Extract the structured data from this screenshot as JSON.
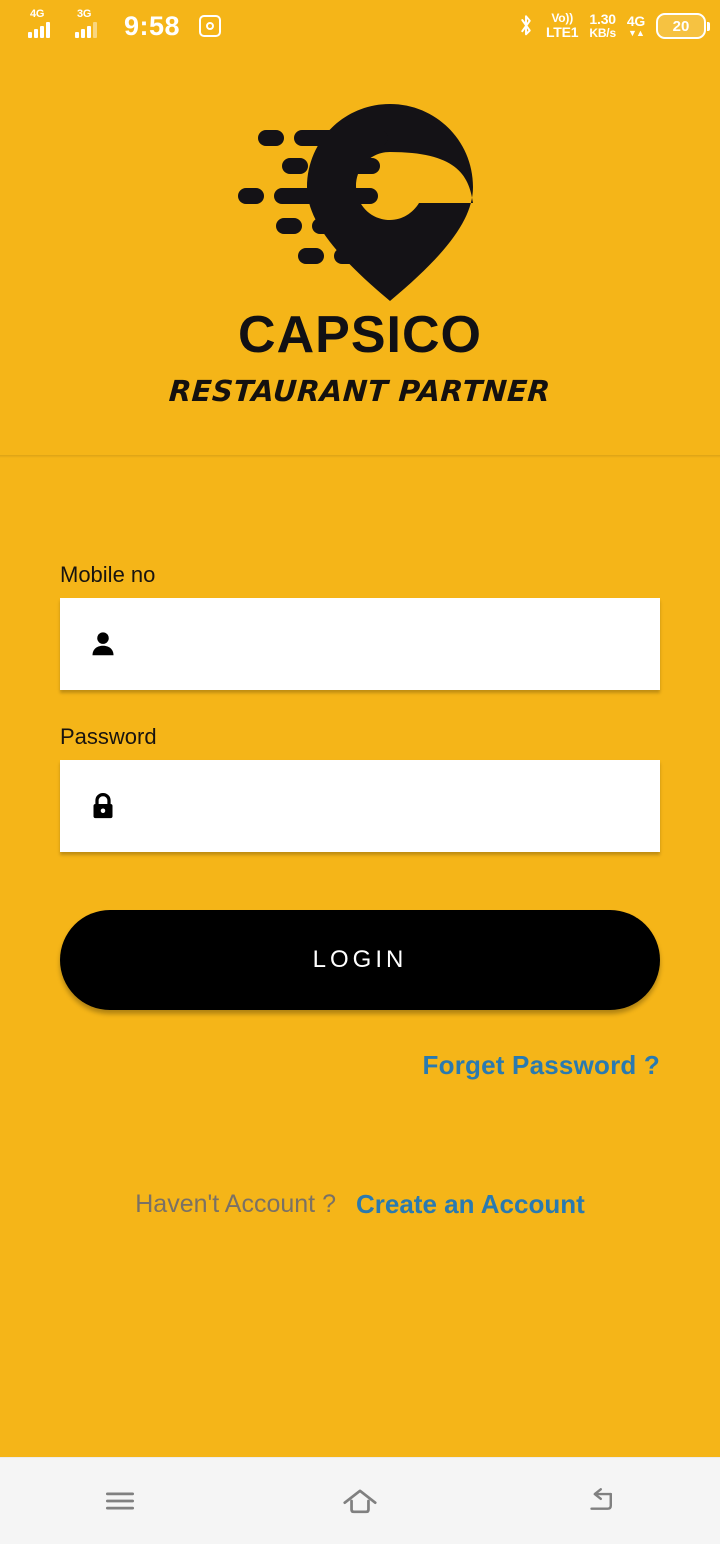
{
  "status_bar": {
    "signal_primary": "4G",
    "signal_secondary": "3G",
    "time": "9:58",
    "camera_icon": "camera-icon",
    "bluetooth_icon": "bluetooth-icon",
    "volte_top": "Vo))",
    "volte_bottom": "LTE1",
    "data_rate_value": "1.30",
    "data_rate_unit": "KB/s",
    "network_type": "4G",
    "network_arrows": "▼▲",
    "battery_level": "20"
  },
  "header": {
    "logo_icon": "capsico-location-pin-logo",
    "brand": "CAPSICO",
    "tagline": "RESTAURANT PARTNER"
  },
  "form": {
    "mobile": {
      "label": "Mobile no",
      "icon": "person-icon",
      "value": "",
      "placeholder": ""
    },
    "password": {
      "label": "Password",
      "icon": "lock-icon",
      "value": "",
      "placeholder": ""
    },
    "login_button": "LOGIN",
    "forget_password": "Forget Password ?",
    "signup_prompt": "Haven't Account ?",
    "signup_link": "Create an Account"
  },
  "nav_bar": {
    "recents": "menu-icon",
    "home": "home-icon",
    "back": "back-icon"
  },
  "colors": {
    "background": "#f5b518",
    "accent_link": "#2a7ab0",
    "button": "#000000",
    "field": "#ffffff",
    "nav_bar": "#f5f5f5"
  }
}
